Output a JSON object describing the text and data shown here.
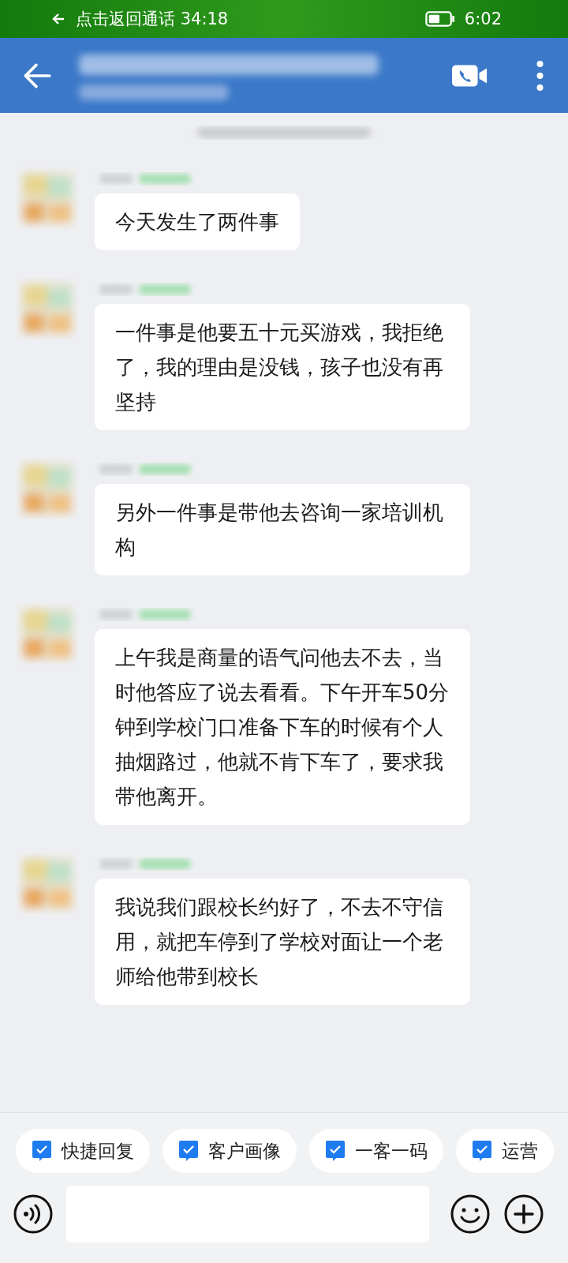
{
  "status_bar": {
    "call_banner": "点击返回通话 34:18",
    "time": "6:02"
  },
  "messages": [
    {
      "text": "今天发生了两件事"
    },
    {
      "text": "一件事是他要五十元买游戏，我拒绝了，我的理由是没钱，孩子也没有再坚持"
    },
    {
      "text": "另外一件事是带他去咨询一家培训机构"
    },
    {
      "text": "上午我是商量的语气问他去不去，当时他答应了说去看看。下午开车50分钟到学校门口准备下车的时候有个人抽烟路过，他就不肯下车了，要求我带他离开。"
    },
    {
      "text": "我说我们跟校长约好了，不去不守信用，就把车停到了学校对面让一个老师给他带到校长"
    }
  ],
  "quick_actions": [
    {
      "label": "快捷回复"
    },
    {
      "label": "客户画像"
    },
    {
      "label": "一客一码"
    },
    {
      "label": "运营"
    }
  ]
}
